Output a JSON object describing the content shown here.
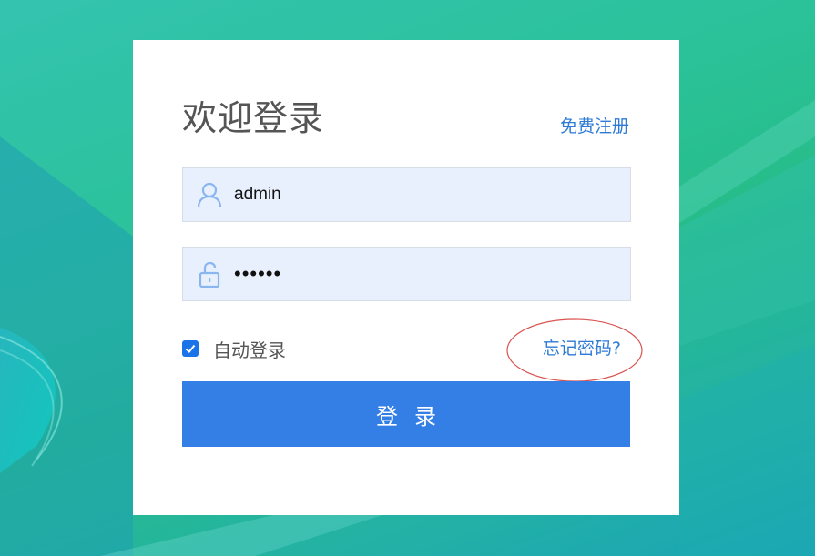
{
  "login": {
    "title": "欢迎登录",
    "register_label": "免费注册",
    "username": {
      "value": "admin",
      "icon": "user-icon"
    },
    "password": {
      "value": "••••••",
      "icon": "unlock-icon"
    },
    "auto_login": {
      "label": "自动登录",
      "checked": true
    },
    "forgot_label": "忘记密码?",
    "login_button_label": "登录"
  },
  "colors": {
    "accent": "#337fe5",
    "link": "#2e7bd6",
    "field_bg": "#e8f0fe",
    "annotation": "#d9534f"
  }
}
